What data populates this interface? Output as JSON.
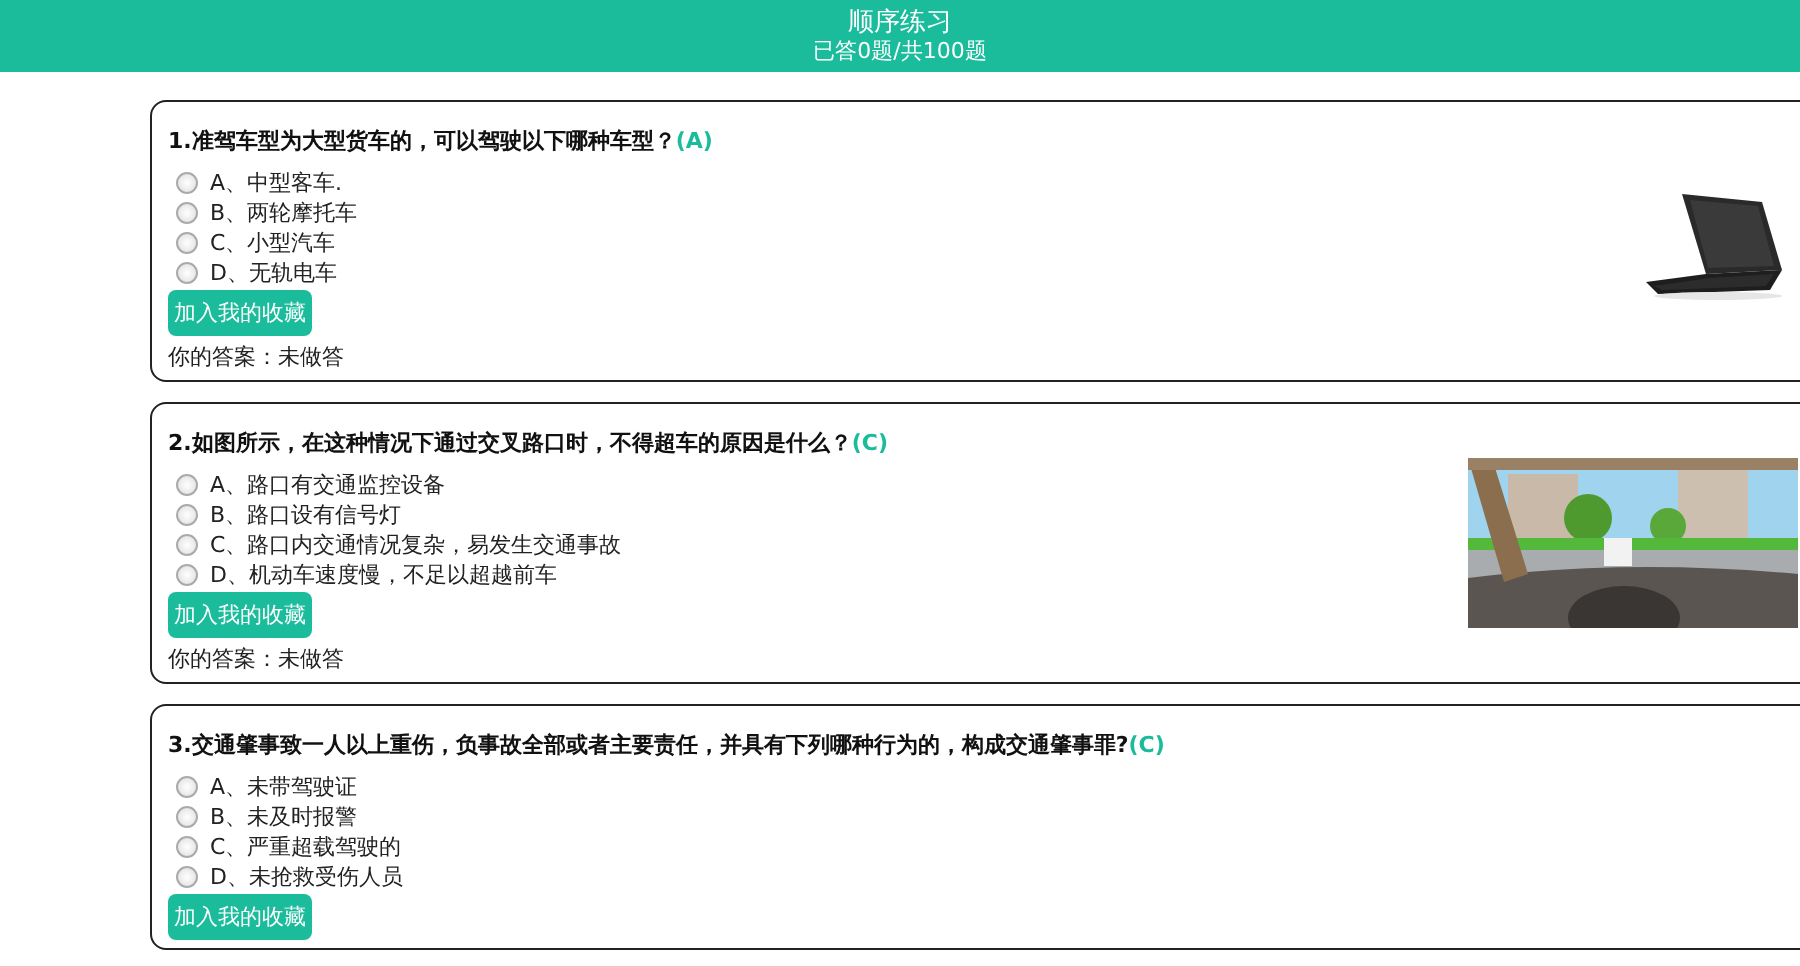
{
  "header": {
    "title": "顺序练习",
    "progress": "已答0题/共100题"
  },
  "questions": [
    {
      "number": "1.",
      "text": "准驾车型为大型货车的，可以驾驶以下哪种车型？",
      "answer": "(A)",
      "options": [
        {
          "label": "A、中型客车.",
          "selected": false
        },
        {
          "label": "B、两轮摩托车",
          "selected": false
        },
        {
          "label": "C、小型汽车",
          "selected": false
        },
        {
          "label": "D、无轨电车",
          "selected": false
        }
      ],
      "button": "加入我的收藏",
      "your_answer": "你的答案：未做答"
    },
    {
      "number": "2.",
      "text": "如图所示，在这种情况下通过交叉路口时，不得超车的原因是什么？",
      "answer": "(C)",
      "options": [
        {
          "label": "A、路口有交通监控设备",
          "selected": false
        },
        {
          "label": "B、路口设有信号灯",
          "selected": false
        },
        {
          "label": "C、路口内交通情况复杂，易发生交通事故",
          "selected": false
        },
        {
          "label": "D、机动车速度慢，不足以超越前车",
          "selected": false
        }
      ],
      "button": "加入我的收藏",
      "your_answer": "你的答案：未做答"
    },
    {
      "number": "3.",
      "text": "交通肇事致一人以上重伤，负事故全部或者主要责任，并具有下列哪种行为的，构成交通肇事罪?",
      "answer": "(C)",
      "options": [
        {
          "label": "A、未带驾驶证",
          "selected": false
        },
        {
          "label": "B、未及时报警",
          "selected": false
        },
        {
          "label": "C、严重超载驾驶的",
          "selected": false
        },
        {
          "label": "D、未抢救受伤人员",
          "selected": false
        }
      ],
      "button": "加入我的收藏"
    }
  ]
}
